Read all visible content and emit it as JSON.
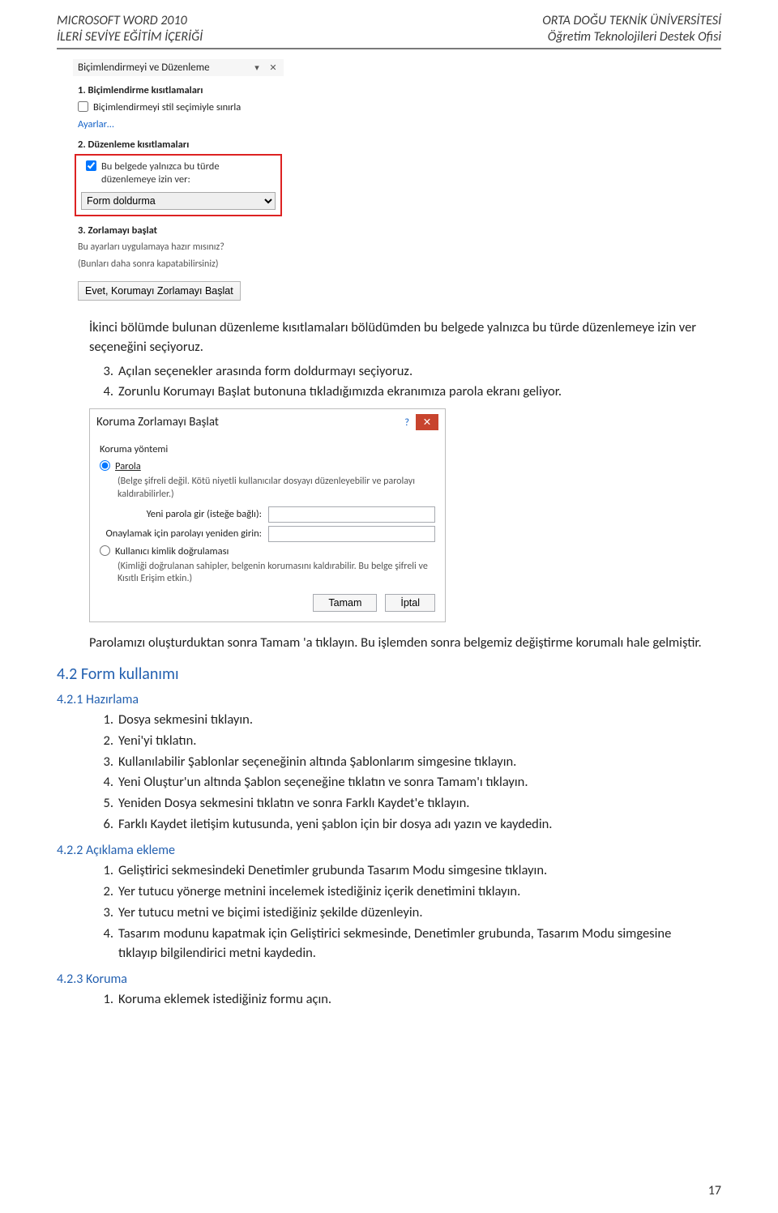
{
  "header": {
    "left_line1": "MICROSOFT WORD 2010",
    "left_line2": "İLERİ SEVİYE EĞİTİM İÇERİĞİ",
    "right_line1": "ORTA DOĞU TEKNİK ÜNİVERSİTESİ",
    "right_line2": "Öğretim Teknolojileri Destek Ofisi"
  },
  "restrict_pane": {
    "title": "Biçimlendirmeyi ve Düzenleme",
    "chevron": "▾",
    "close_glyph": "✕",
    "sec1_title": "1. Biçimlendirme kısıtlamaları",
    "sec1_checkbox": "Biçimlendirmeyi stil seçimiyle sınırla",
    "sec1_link": "Ayarlar…",
    "sec2_title": "2. Düzenleme kısıtlamaları",
    "sec2_checkbox": "Bu belgede yalnızca bu türde düzenlemeye izin ver:",
    "sec2_select": "Form doldurma",
    "sec3_title": "3. Zorlamayı başlat",
    "sec3_text1": "Bu ayarları uygulamaya hazır mısınız?",
    "sec3_text2": "(Bunları daha sonra kapatabilirsiniz)",
    "sec3_button": "Evet, Korumayı Zorlamayı Başlat"
  },
  "intro": {
    "p1": "İkinci bölümde bulunan düzenleme kısıtlamaları bölüdümden bu belgede yalnızca bu türde düzenlemeye izin ver seçeneğini seçiyoruz.",
    "li3_num": "3.",
    "li3": "Açılan seçenekler arasında form doldurmayı seçiyoruz.",
    "li4_num": "4.",
    "li4": "Zorunlu Korumayı Başlat butonuna tıkladığımızda ekranımıza parola ekranı geliyor."
  },
  "pwd_dialog": {
    "title": "Koruma Zorlamayı Başlat",
    "help_glyph": "?",
    "close_glyph": "✕",
    "section_label": "Koruma yöntemi",
    "radio_password": "Parola",
    "password_desc": "(Belge şifreli değil. Kötü niyetli kullanıcılar dosyayı düzenleyebilir ve parolayı kaldırabilirler.)",
    "new_pass_label": "Yeni parola gir (isteğe bağlı):",
    "confirm_pass_label": "Onaylamak için parolayı yeniden girin:",
    "radio_user": "Kullanıcı kimlik doğrulaması",
    "user_desc": "(Kimliği doğrulanan sahipler, belgenin korumasını kaldırabilir. Bu belge şifreli ve Kısıtlı Erişim etkin.)",
    "btn_ok": "Tamam",
    "btn_cancel": "İptal"
  },
  "after_pwd": {
    "p": "Parolamızı oluşturduktan sonra Tamam 'a tıklayın. Bu işlemden sonra belgemiz değiştirme korumalı hale gelmiştir."
  },
  "sec42": {
    "title": "4.2 Form kullanımı"
  },
  "sec421": {
    "title": "4.2.1 Hazırlama",
    "items": {
      "n1": "1.",
      "t1": "Dosya sekmesini tıklayın.",
      "n2": "2.",
      "t2": "Yeni'yi tıklatın.",
      "n3": "3.",
      "t3": "Kullanılabilir Şablonlar seçeneğinin altında Şablonlarım simgesine tıklayın.",
      "n4": "4.",
      "t4": "Yeni Oluştur'un altında Şablon seçeneğine tıklatın ve sonra Tamam'ı tıklayın.",
      "n5": "5.",
      "t5": "Yeniden Dosya sekmesini tıklatın ve sonra Farklı Kaydet'e tıklayın.",
      "n6": "6.",
      "t6": "Farklı Kaydet iletişim kutusunda, yeni şablon için bir dosya adı yazın ve kaydedin."
    }
  },
  "sec422": {
    "title": "4.2.2 Açıklama ekleme",
    "items": {
      "n1": "1.",
      "t1": "Geliştirici sekmesindeki Denetimler grubunda Tasarım Modu simgesine tıklayın.",
      "n2": "2.",
      "t2": "Yer tutucu yönerge metnini incelemek istediğiniz içerik denetimini tıklayın.",
      "n3": "3.",
      "t3": "Yer tutucu metni ve biçimi istediğiniz şekilde düzenleyin.",
      "n4": "4.",
      "t4": "Tasarım modunu kapatmak için Geliştirici sekmesinde, Denetimler grubunda, Tasarım Modu simgesine tıklayıp bilgilendirici metni kaydedin."
    }
  },
  "sec423": {
    "title": "4.2.3 Koruma",
    "items": {
      "n1": "1.",
      "t1": "Koruma eklemek istediğiniz formu açın."
    }
  },
  "page_number": "17"
}
